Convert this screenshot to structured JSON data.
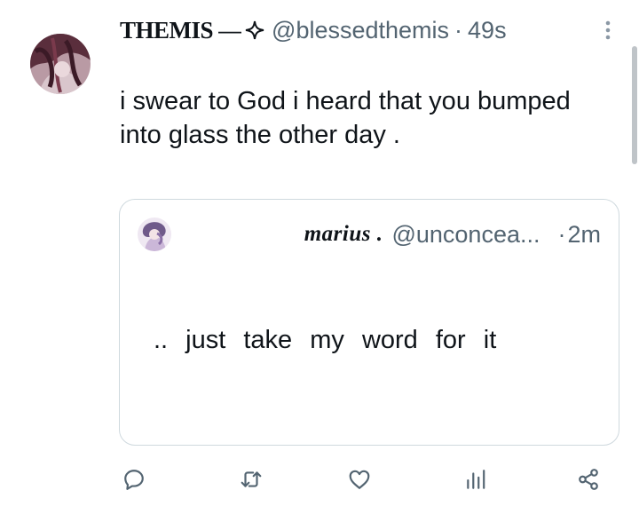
{
  "tweet": {
    "author_name": "THEMIS",
    "name_separator": "—",
    "handle": "@blessedthemis",
    "separator_dot": "·",
    "time": "49s",
    "text": "i swear to God i heard that you bumped into glass the other day ."
  },
  "quote": {
    "author_name": "marius .",
    "handle": "@unconcea...",
    "separator_dot": "·",
    "time": "2m",
    "text": ".. just take my word for it"
  },
  "actions": {
    "icons": [
      "reply-icon",
      "retweet-icon",
      "like-icon",
      "views-icon",
      "share-icon"
    ]
  },
  "colors": {
    "text": "#0f1419",
    "secondary": "#536471",
    "border": "#cfd9de",
    "icon": "#536471"
  }
}
